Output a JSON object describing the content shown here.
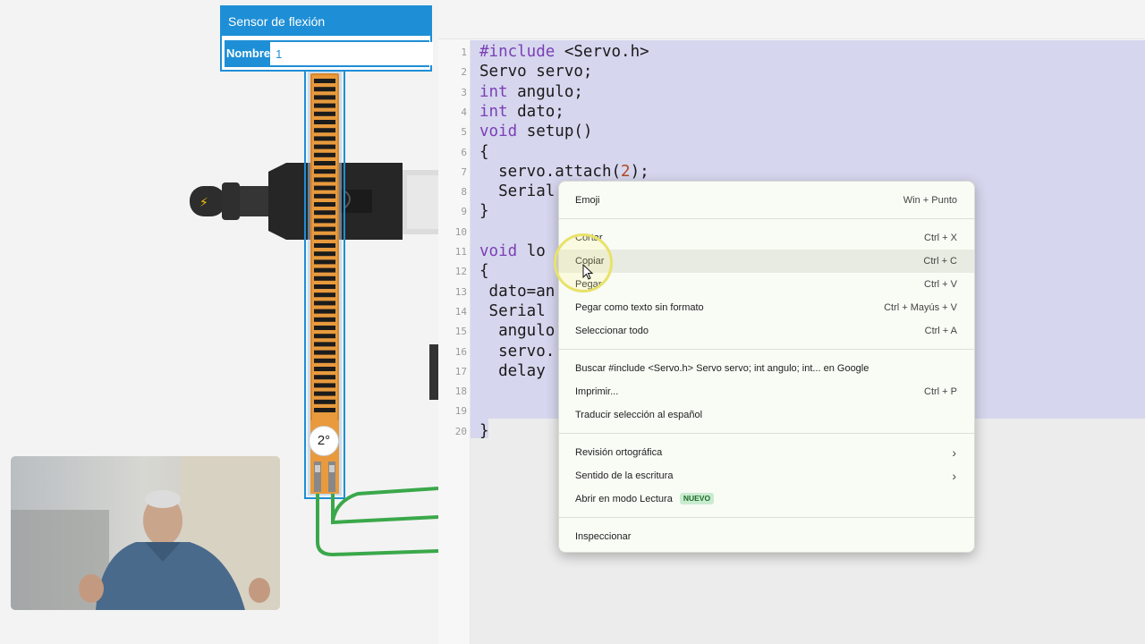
{
  "properties_panel": {
    "title": "Sensor de flexión",
    "name_label": "Nombre",
    "name_value": "1"
  },
  "flex_sensor": {
    "angle_readout": "2°"
  },
  "editor": {
    "line_numbers": [
      "1",
      "2",
      "3",
      "4",
      "5",
      "6",
      "7",
      "8",
      "9",
      "10",
      "11",
      "12",
      "13",
      "14",
      "15",
      "16",
      "17",
      "18",
      "19",
      "20"
    ],
    "lines": [
      "#include <Servo.h>",
      "Servo servo;",
      "int angulo;",
      "int dato;",
      "void setup()",
      "{",
      "  servo.attach(2);",
      "  Serial",
      "}",
      "",
      "void lo",
      "{",
      " dato=an",
      " Serial",
      "  angulo",
      "  servo.",
      "  delay",
      "",
      "",
      "}"
    ]
  },
  "context_menu": {
    "items": [
      {
        "label": "Emoji",
        "shortcut": "Win + Punto"
      },
      {
        "label": "Cortar",
        "shortcut": "Ctrl + X"
      },
      {
        "label": "Copiar",
        "shortcut": "Ctrl + C"
      },
      {
        "label": "Pegar",
        "shortcut": "Ctrl + V"
      },
      {
        "label": "Pegar como texto sin formato",
        "shortcut": "Ctrl + Mayús + V"
      },
      {
        "label": "Seleccionar todo",
        "shortcut": "Ctrl + A"
      },
      {
        "label": "Buscar #include <Servo.h> Servo servo; int angulo; int... en Google",
        "shortcut": ""
      },
      {
        "label": "Imprimir...",
        "shortcut": "Ctrl + P"
      },
      {
        "label": "Traducir selección al español",
        "shortcut": ""
      },
      {
        "label": "Revisión ortográfica",
        "shortcut": ""
      },
      {
        "label": "Sentido de la escritura",
        "shortcut": ""
      },
      {
        "label": "Abrir en modo Lectura",
        "shortcut": "",
        "badge": "NUEVO"
      },
      {
        "label": "Inspeccionar",
        "shortcut": ""
      }
    ],
    "hover_item": "Copiar"
  },
  "colors": {
    "accent": "#1e8fd6",
    "wire_green": "#3aa84a",
    "selection": "#d6d6ee",
    "keyword_purple": "#7a3fb5",
    "number_color": "#b0481f"
  }
}
